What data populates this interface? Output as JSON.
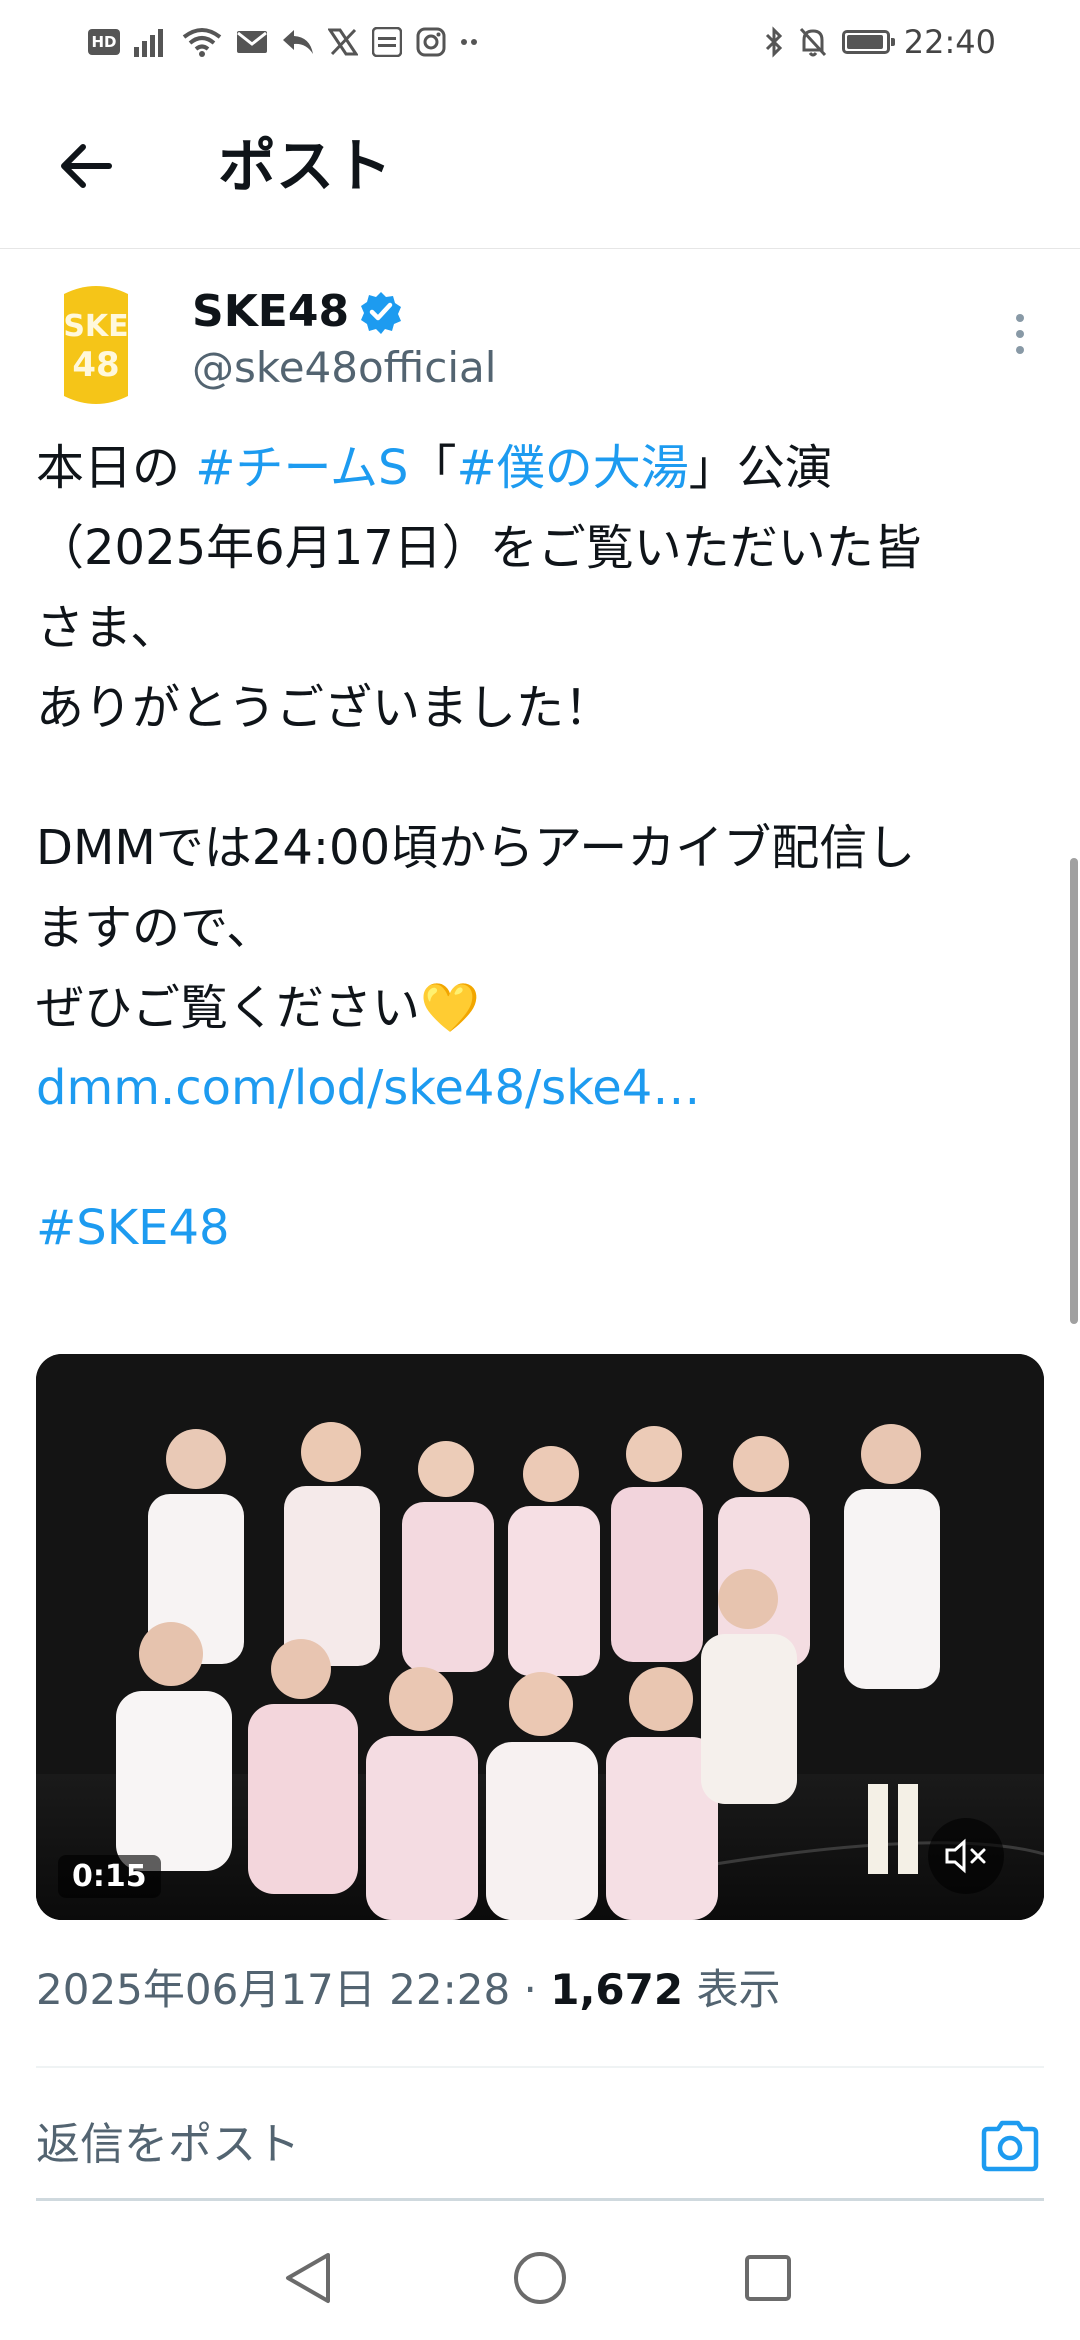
{
  "status_bar": {
    "hd_label": "HD",
    "time": "22:40",
    "battery_level": 0.95,
    "icons": [
      "signal-icon",
      "wifi-icon",
      "mail-icon",
      "reply-icon",
      "x-icon",
      "showroom-icon",
      "instagram-icon",
      "more-dots-icon",
      "bluetooth-icon",
      "bell-off-icon",
      "battery-icon"
    ]
  },
  "header": {
    "title": "ポスト",
    "back_icon": "arrow-left-icon"
  },
  "author": {
    "name": "SKE48",
    "handle": "@ske48official",
    "verified": true,
    "avatar_text": "SKE48"
  },
  "tweet": {
    "line1_prefix": "本日の ",
    "line1_hashtag1": "#チームS",
    "line1_open": "「",
    "line1_hashtag2": "#僕の大湯",
    "line1_suffix": "」公演",
    "line2": "（2025年6月17日）をご覧いただいた皆",
    "line3": "さま、",
    "line4": "ありがとうございました！",
    "line5": "DMMでは24:00頃からアーカイブ配信し",
    "line6": "ますので、",
    "line7": "ぜひご覧ください💛",
    "link": "dmm.com/lod/ske48/ske4…",
    "hashtag": "#SKE48"
  },
  "media": {
    "duration": "0:15",
    "muted": true
  },
  "meta": {
    "timestamp": "2025年06月17日 22:28",
    "separator": " · ",
    "views": "1,672",
    "views_label": " 表示"
  },
  "reply": {
    "placeholder": "返信をポスト"
  },
  "colors": {
    "accent": "#1d9bf0",
    "text": "#0f1419",
    "secondary": "#536471",
    "logo_gold": "#f5c518"
  }
}
